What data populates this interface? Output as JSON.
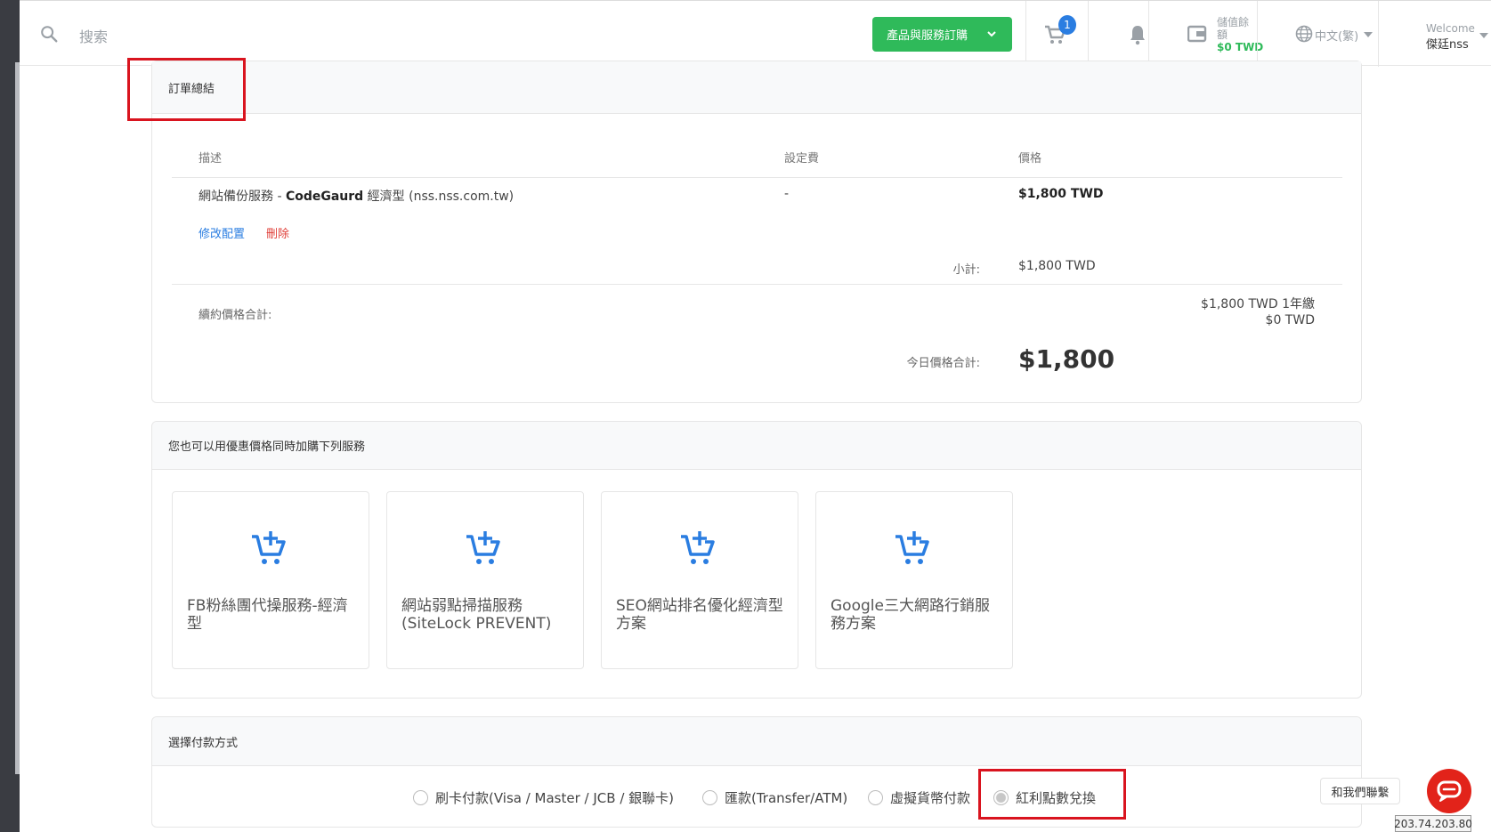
{
  "topbar": {
    "search_placeholder": "搜索",
    "order_button": "產品與服務訂購",
    "cart_count": "1",
    "wallet_label": "儲值餘額",
    "wallet_amount": "$0 TWD",
    "language": "中文(繁)",
    "welcome": "Welcome",
    "user_name": "傑廷nss"
  },
  "summary": {
    "title": "訂單總結",
    "columns": [
      "描述",
      "設定費",
      "價格"
    ],
    "item": {
      "desc_prefix": "網站備份服務 - ",
      "desc_bold": "CodeGaurd",
      "desc_suffix": " 經濟型 (nss.nss.com.tw)",
      "setup_fee": "-",
      "price": "$1,800 TWD",
      "edit_link": "修改配置",
      "delete_link": "刪除"
    },
    "subtotal_label": "小計:",
    "subtotal_value": "$1,800 TWD",
    "renew_label": "續約價格合計:",
    "renew_value_1": "$1,800 TWD 1年繳",
    "renew_value_2": "$0 TWD",
    "today_label": "今日價格合計:",
    "today_value": "$1,800"
  },
  "addons": {
    "title": "您也可以用優惠價格同時加購下列服務",
    "items": [
      {
        "label": "FB粉絲團代操服務-經濟型"
      },
      {
        "label": "網站弱點掃描服務(SiteLock PREVENT)"
      },
      {
        "label": "SEO網站排名優化經濟型方案"
      },
      {
        "label": "Google三大網路行銷服務方案"
      }
    ]
  },
  "payment": {
    "title": "選擇付款方式",
    "options": [
      {
        "label": "刷卡付款(Visa / Master / JCB / 銀聯卡)"
      },
      {
        "label": "匯款(Transfer/ATM)"
      },
      {
        "label": "虛擬貨幣付款"
      },
      {
        "label": "紅利點數兌換"
      }
    ],
    "selected_index": 3
  },
  "contact_label": "和我們聯繫",
  "ip_address": "203.74.203.80",
  "colors": {
    "accent_green": "#2fba5a",
    "accent_blue": "#2a7de1",
    "highlight_red": "#d9141f",
    "chat_red": "#e2231a"
  }
}
